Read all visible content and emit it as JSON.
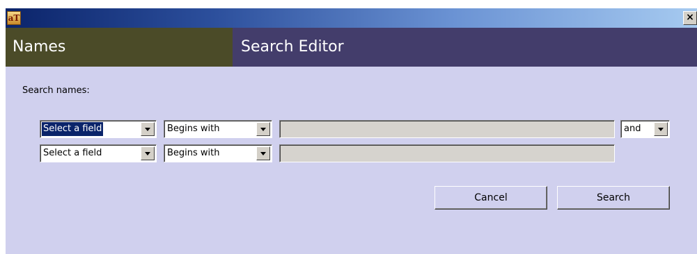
{
  "titlebar": {
    "app_icon_text": "aT",
    "close_label": "×"
  },
  "banner": {
    "left_title": "Names",
    "right_title": "Search Editor"
  },
  "form": {
    "label": "Search names:",
    "rows": [
      {
        "field": "Select a field",
        "operator": "Begins with",
        "value": "",
        "conjunction": "and"
      },
      {
        "field": "Select a field",
        "operator": "Begins with",
        "value": ""
      }
    ]
  },
  "buttons": {
    "cancel": "Cancel",
    "search": "Search"
  },
  "colors": {
    "window_bg": "#d0d0ee",
    "banner_left": "#4b4b28",
    "banner_right": "#433d6b",
    "selection": "#0a246a"
  }
}
